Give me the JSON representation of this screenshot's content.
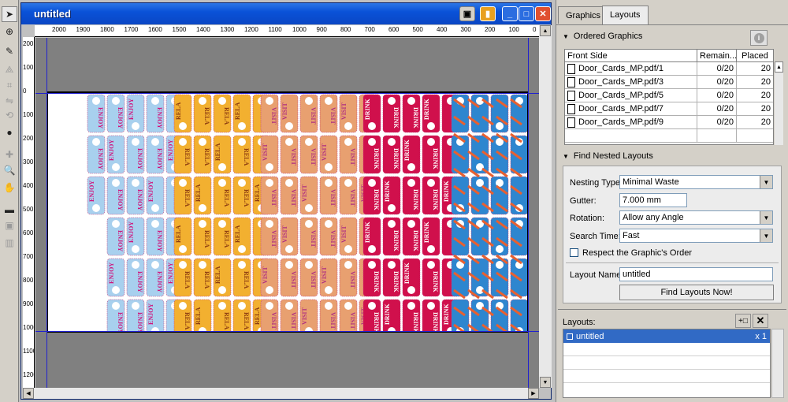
{
  "tools": [
    "arrow-tool",
    "node-tool",
    "line-tool",
    "crop-tool",
    "transform-tool",
    "mirror-tool",
    "rotate-tool",
    "ink-tool",
    "eyedropper-tool",
    "zoom-tool",
    "hand-tool",
    "ruler-tool",
    "shape-tool",
    "layer-tool"
  ],
  "window": {
    "title": "untitled"
  },
  "ruler_top": [
    "2000",
    "1900",
    "1800",
    "1700",
    "1600",
    "1500",
    "1400",
    "1300",
    "1200",
    "1100",
    "1000",
    "900",
    "800",
    "700",
    "600",
    "500",
    "400",
    "300",
    "200",
    "100",
    "0"
  ],
  "ruler_left": [
    "200",
    "100",
    "0",
    "100",
    "200",
    "300",
    "400",
    "500",
    "600",
    "700",
    "800",
    "900",
    "1000",
    "1100",
    "1200"
  ],
  "graphics_colors": {
    "enjoy": "#a8d0ee",
    "relax": "#f2b030",
    "visit": "#e8a070",
    "drink": "#d0104c",
    "stars": "#2e86cf"
  },
  "graphics_text": {
    "enjoy": "ENJOY",
    "relax": "RELA",
    "visit": "VISIT",
    "drink": "DRINK"
  },
  "panel": {
    "tabs": [
      "Graphics",
      "Layouts"
    ],
    "ordered_title": "Ordered Graphics",
    "columns": [
      "Front Side",
      "Remain...",
      "Placed"
    ],
    "rows": [
      {
        "name": "Door_Cards_MP.pdf/1",
        "remain": "0/20",
        "placed": "20"
      },
      {
        "name": "Door_Cards_MP.pdf/3",
        "remain": "0/20",
        "placed": "20"
      },
      {
        "name": "Door_Cards_MP.pdf/5",
        "remain": "0/20",
        "placed": "20"
      },
      {
        "name": "Door_Cards_MP.pdf/7",
        "remain": "0/20",
        "placed": "20"
      },
      {
        "name": "Door_Cards_MP.pdf/9",
        "remain": "0/20",
        "placed": "20"
      }
    ],
    "nested_title": "Find Nested Layouts",
    "nesting_label": "Nesting Type:",
    "nesting_value": "Minimal Waste",
    "gutter_label": "Gutter:",
    "gutter_value": "7.000 mm",
    "rotation_label": "Rotation:",
    "rotation_value": "Allow any Angle",
    "search_label": "Search Time:",
    "search_value": "Fast",
    "respect_label": "Respect the Graphic's Order",
    "layout_name_label": "Layout Name:",
    "layout_name_value": "untitled",
    "find_button": "Find Layouts Now!",
    "layouts_label": "Layouts:",
    "layouts": [
      {
        "name": "untitled",
        "count": "x 1"
      }
    ]
  }
}
